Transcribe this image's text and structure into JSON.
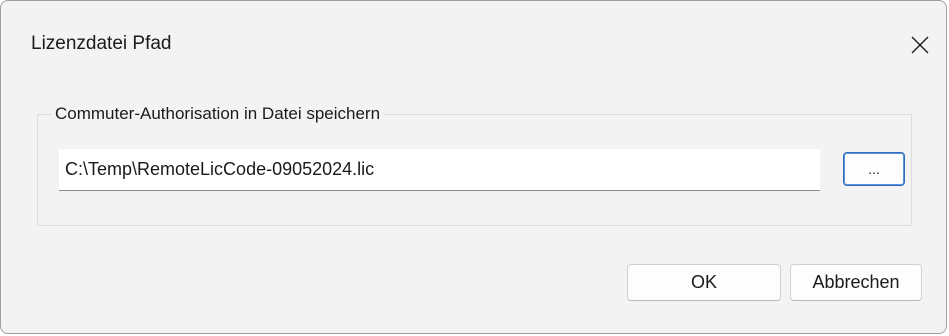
{
  "window": {
    "title": "Lizenzdatei Pfad",
    "close_icon": "close-icon"
  },
  "group": {
    "label": "Commuter-Authorisation in Datei speichern"
  },
  "path_field": {
    "value": "C:\\Temp\\RemoteLicCode-09052024.lic"
  },
  "browse_button": {
    "label": "..."
  },
  "buttons": {
    "ok_label": "OK",
    "cancel_label": "Abbrechen"
  },
  "colors": {
    "dialog_bg": "#f3f3f3",
    "accent_border": "#2f6cbf"
  }
}
